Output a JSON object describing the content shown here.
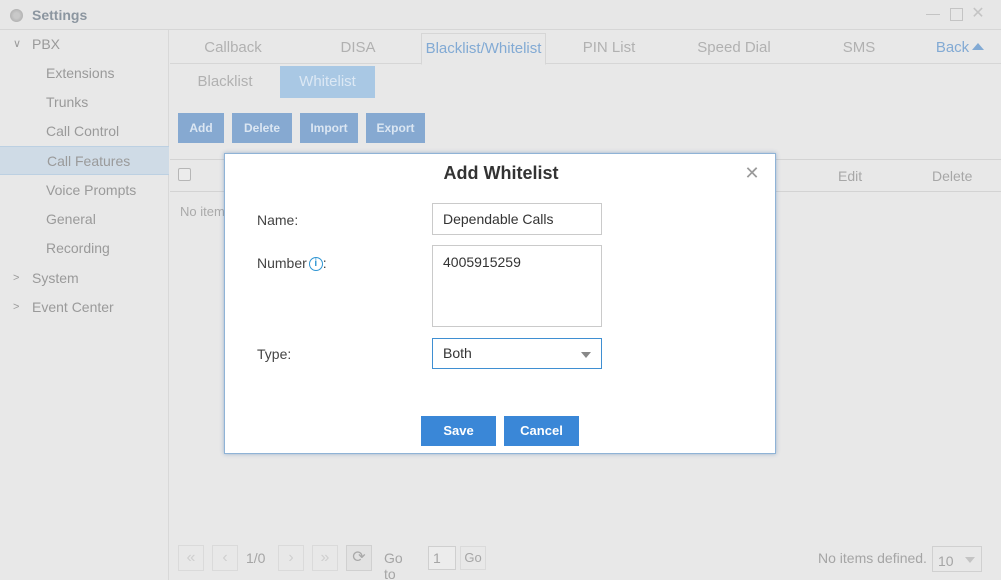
{
  "window": {
    "title": "Settings",
    "icon": "gear-icon",
    "controls": [
      "minimize",
      "maximize",
      "close"
    ]
  },
  "sidebar": {
    "groups": [
      {
        "label": "PBX",
        "expanded": true,
        "items": [
          {
            "label": "Extensions"
          },
          {
            "label": "Trunks"
          },
          {
            "label": "Call Control"
          },
          {
            "label": "Call Features",
            "active": true
          },
          {
            "label": "Voice Prompts"
          },
          {
            "label": "General"
          },
          {
            "label": "Recording"
          }
        ]
      },
      {
        "label": "System",
        "expanded": false
      },
      {
        "label": "Event Center",
        "expanded": false
      }
    ]
  },
  "tabs": [
    {
      "label": "Callback"
    },
    {
      "label": "DISA"
    },
    {
      "label": "Blacklist/Whitelist",
      "active": true
    },
    {
      "label": "PIN List"
    },
    {
      "label": "Speed Dial"
    },
    {
      "label": "SMS"
    }
  ],
  "back_label": "Back",
  "subtabs": [
    {
      "label": "Blacklist"
    },
    {
      "label": "Whitelist",
      "active": true
    }
  ],
  "actions": {
    "add": "Add",
    "delete": "Delete",
    "import": "Import",
    "export": "Export"
  },
  "table": {
    "columns": [
      "Edit",
      "Delete"
    ],
    "empty_message": "No items defined."
  },
  "pagination": {
    "page_indicator": "1/0",
    "goto_label": "Go to",
    "goto_value": "1",
    "go_button": "Go",
    "status": "No items defined.",
    "page_size": "10"
  },
  "modal": {
    "title": "Add Whitelist",
    "fields": {
      "name": {
        "label": "Name:",
        "value": "Dependable Calls"
      },
      "number": {
        "label": "Number",
        "label_suffix": ":",
        "value": "4005915259",
        "info_icon": "i"
      },
      "type": {
        "label": "Type:",
        "value": "Both"
      }
    },
    "save": "Save",
    "cancel": "Cancel"
  },
  "colors": {
    "primary_button": "#3a87d7",
    "active_tab_text": "#82aad4",
    "sidebar_active_bg": "#cfdbe6"
  }
}
